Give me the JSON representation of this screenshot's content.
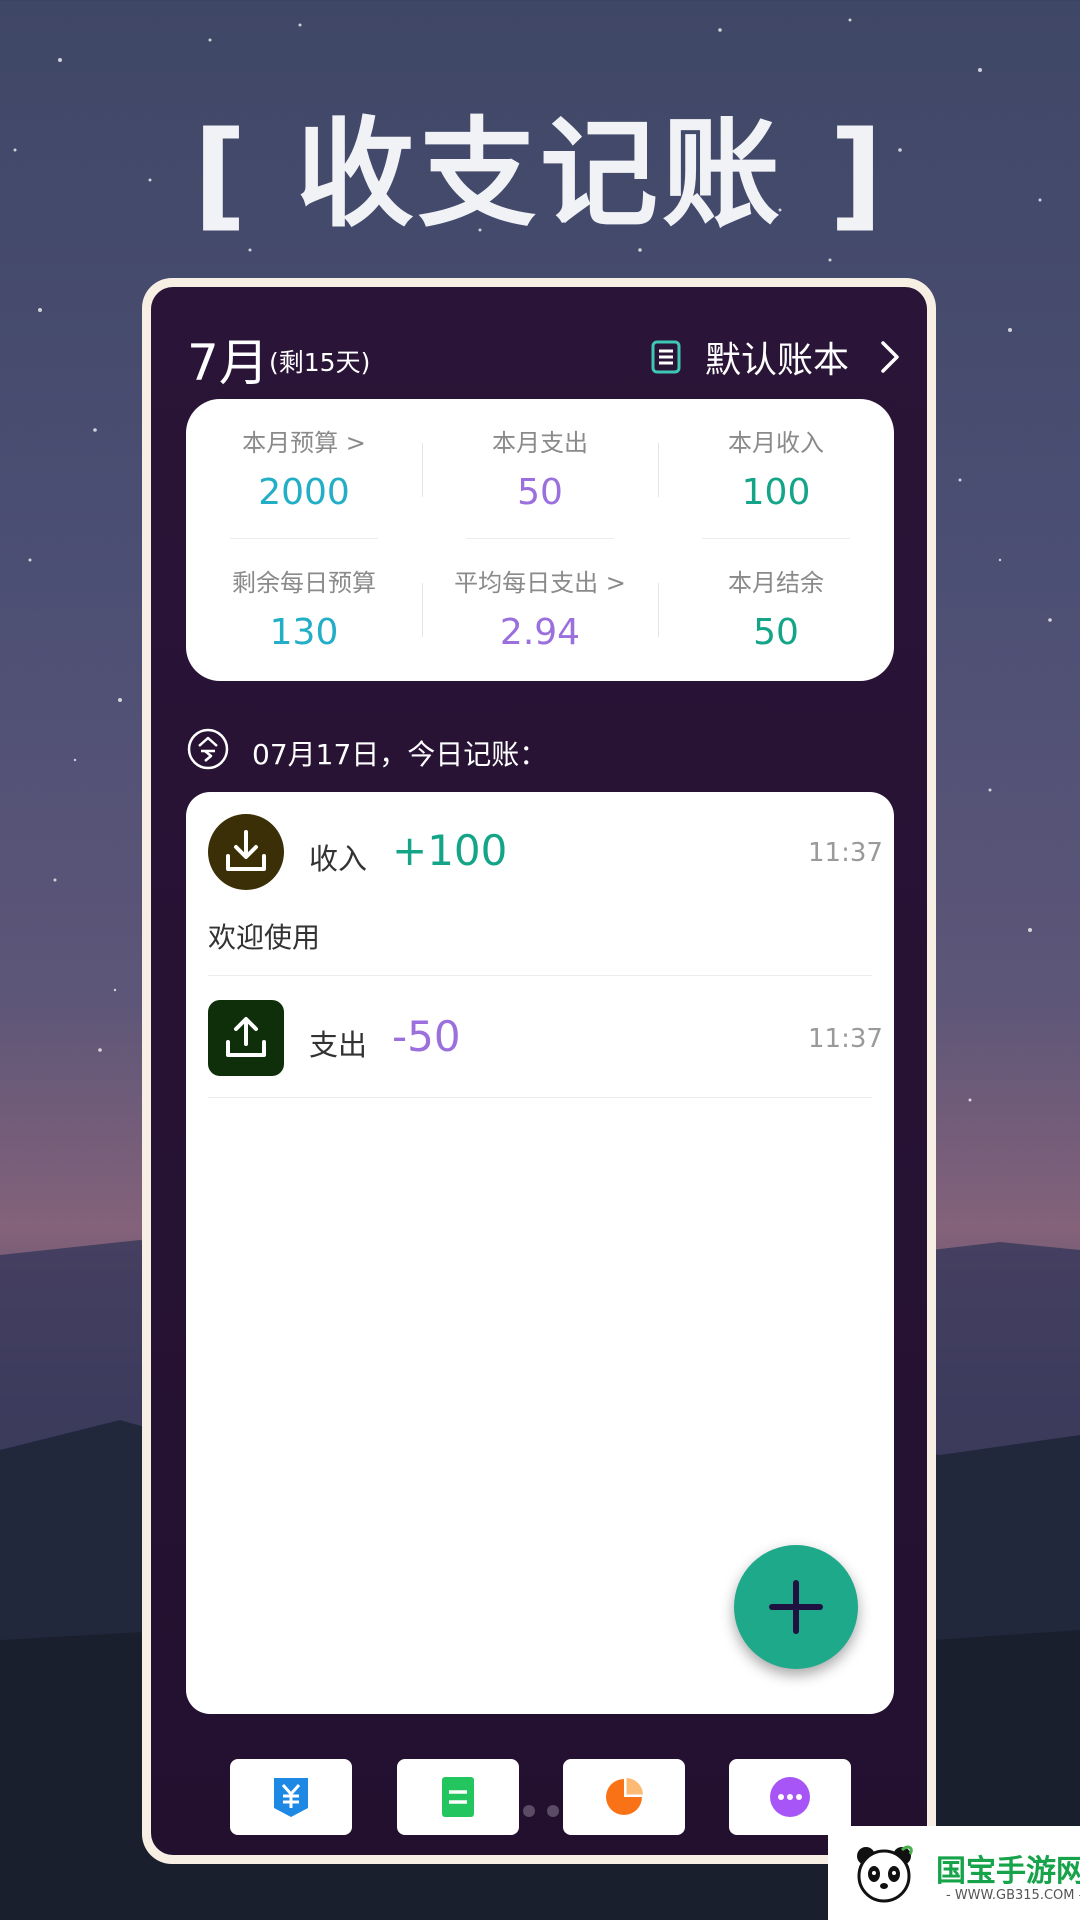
{
  "poster": {
    "title": "[ 收支记账 ]"
  },
  "header": {
    "month": "7月",
    "remaining": "(剩15天)",
    "book_label": "默认账本",
    "book_icon": "ledger-icon"
  },
  "stats": {
    "row1": [
      {
        "label": "本月预算",
        "value": "2000",
        "color": "#21aec6",
        "has_chevron": true
      },
      {
        "label": "本月支出",
        "value": "50",
        "color": "#9b6fdc",
        "has_chevron": false
      },
      {
        "label": "本月收入",
        "value": "100",
        "color": "#14a589",
        "has_chevron": false
      }
    ],
    "row2": [
      {
        "label": "剩余每日预算",
        "value": "130",
        "color": "#21aec6",
        "has_chevron": false
      },
      {
        "label": "平均每日支出",
        "value": "2.94",
        "color": "#9b6fdc",
        "has_chevron": true
      },
      {
        "label": "本月结余",
        "value": "50",
        "color": "#14a589",
        "has_chevron": false
      }
    ]
  },
  "today": {
    "label": "07月17日，今日记账："
  },
  "records": [
    {
      "type": "收入",
      "amount": "+100",
      "time": "11:37",
      "note": "欢迎使用",
      "icon": "download-icon",
      "icon_bg": "#3b2f07",
      "amount_color": "#14a589"
    },
    {
      "type": "支出",
      "amount": "-50",
      "time": "11:37",
      "note": "",
      "icon": "upload-icon",
      "icon_bg": "#0f2e0a",
      "amount_color": "#9b6fdc"
    }
  ],
  "fab": {
    "icon": "plus-icon",
    "color": "#1fa98b"
  },
  "bottom_nav": [
    {
      "name": "yuan-icon",
      "color": "#1e88e5"
    },
    {
      "name": "list-icon",
      "color": "#22c55e"
    },
    {
      "name": "pie-chart-icon",
      "color": "#f97316"
    },
    {
      "name": "more-icon",
      "color": "#a855f7"
    }
  ],
  "watermark": {
    "brand": "国宝手游网",
    "site": "- WWW.GB315.COM -"
  }
}
